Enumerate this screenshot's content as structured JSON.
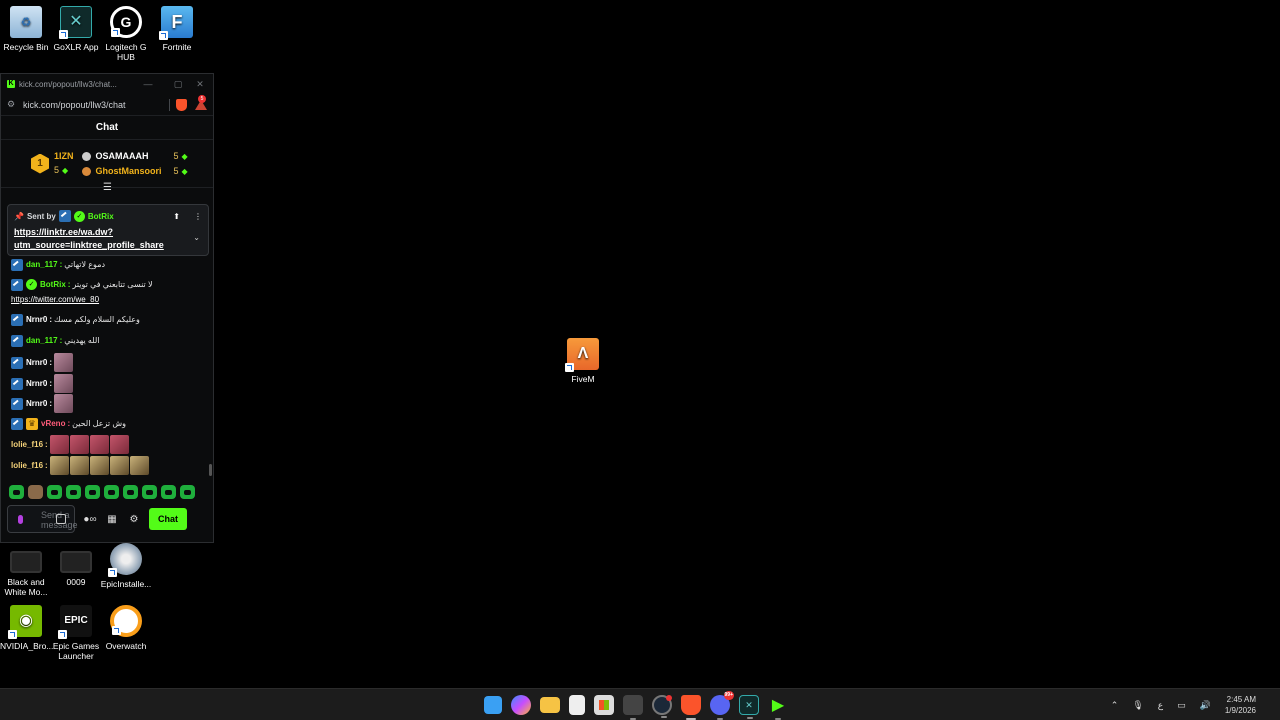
{
  "desktop": {
    "icons": [
      {
        "label": "Recycle Bin",
        "icon": "recycle-bin-icon"
      },
      {
        "label": "GoXLR App",
        "icon": "goxlr-icon"
      },
      {
        "label": "Logitech G HUB",
        "icon": "logitech-g-icon"
      },
      {
        "label": "Fortnite",
        "icon": "fortnite-icon"
      },
      {
        "label": "FiveM",
        "icon": "fivem-icon"
      },
      {
        "label": "Black and White Mo...",
        "icon": "video-file-icon"
      },
      {
        "label": "0009",
        "icon": "video-file-icon"
      },
      {
        "label": "EpicInstalle...",
        "icon": "installer-disc-icon"
      },
      {
        "label": "NVIDIA_Bro...",
        "icon": "nvidia-icon"
      },
      {
        "label": "Epic Games Launcher",
        "icon": "epic-games-icon"
      },
      {
        "label": "Overwatch",
        "icon": "overwatch-icon"
      }
    ]
  },
  "browser": {
    "tab_title": "kick.com/popout/llw3/chat...",
    "address": "kick.com/popout/llw3/chat",
    "notification_count": "5"
  },
  "chat": {
    "header": "Chat",
    "leaderboard": {
      "rank": "1",
      "top_name": "1IZN",
      "top_count": "5",
      "second": {
        "name": "OSAMAAAH",
        "count": "5"
      },
      "third": {
        "name": "GhostMansoori",
        "count": "5"
      }
    },
    "pinned": {
      "sent_by_label": "Sent by",
      "user": "BotRix",
      "link": "https://linktr.ee/wa.dw?utm_source=linktree_profile_share"
    },
    "messages": [
      {
        "user": "dan_117",
        "text": "دموع لاتهاتي",
        "badges": [
          "mod"
        ],
        "color": "#53fc18"
      },
      {
        "user": "BotRix",
        "text": "لا تنسى تتابعني في تويتر",
        "url": "https://twitter.com/we_80",
        "badges": [
          "mod",
          "verified"
        ],
        "color": "#53fc18"
      },
      {
        "user": "Nrnr0",
        "text": "وعليكم السلام ولكم مسك",
        "badges": [
          "mod"
        ],
        "color": "#ffffff"
      },
      {
        "user": "dan_117",
        "text": "الله يهديني",
        "badges": [
          "mod"
        ],
        "color": "#53fc18"
      },
      {
        "user": "Nrnr0",
        "text": "",
        "emotes": 1,
        "badges": [
          "mod"
        ],
        "color": "#ffffff"
      },
      {
        "user": "Nrnr0",
        "text": "",
        "emotes": 1,
        "badges": [
          "mod"
        ],
        "color": "#ffffff"
      },
      {
        "user": "Nrnr0",
        "text": "",
        "emotes": 1,
        "badges": [
          "mod"
        ],
        "color": "#ffffff"
      },
      {
        "user": "vReno",
        "text": "وش تزعل الحين",
        "badges": [
          "mod",
          "crown"
        ],
        "color": "#ff5c7a"
      },
      {
        "user": "lolie_f16",
        "text": "",
        "emotes": 4,
        "badges": [],
        "color": "#f5d37a"
      },
      {
        "user": "lolie_f16",
        "text": "",
        "emotes": 5,
        "badges": [],
        "color": "#f5d37a"
      }
    ],
    "composer": {
      "placeholder": "Send a message",
      "chat_button": "Chat"
    }
  },
  "taskbar": {
    "time": "2:45 AM",
    "date": "1/9/2026",
    "input_language": "ع",
    "discord_badge": "99+"
  },
  "colors": {
    "kick_green": "#53fc18",
    "gold": "#f2b31b",
    "desktop": "#000000",
    "taskbar": "#1c1c1c"
  }
}
